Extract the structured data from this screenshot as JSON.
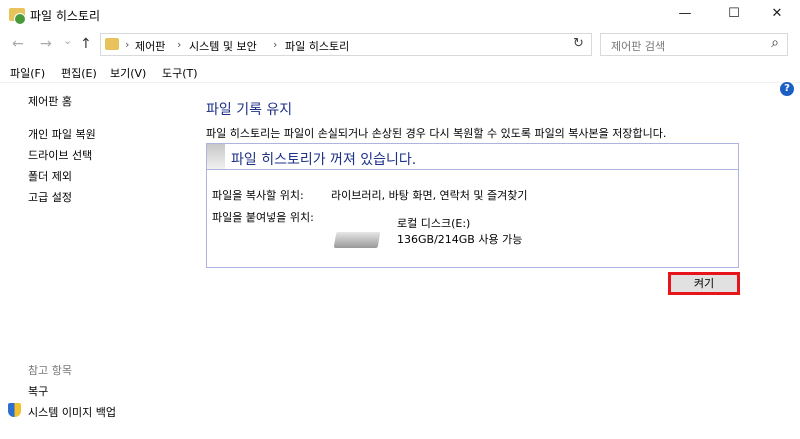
{
  "window": {
    "title": "파일 히스토리",
    "minimize": "—",
    "maximize": "☐",
    "close": "✕"
  },
  "nav": {
    "back": "←",
    "forward": "→",
    "recent": "⌄",
    "up": "↑",
    "refresh": "↻"
  },
  "breadcrumb": [
    "제어판",
    "시스템 및 보안",
    "파일 히스토리"
  ],
  "search": {
    "placeholder": "제어판 검색",
    "icon": "⌕"
  },
  "menu": [
    "파일(F)",
    "편집(E)",
    "보기(V)",
    "도구(T)"
  ],
  "sidebar": {
    "home": "제어판 홈",
    "items": [
      "개인 파일 복원",
      "드라이브 선택",
      "폴더 제외",
      "고급 설정"
    ],
    "see_also": "참고 항목",
    "links": [
      "복구",
      "시스템 이미지 백업"
    ]
  },
  "main": {
    "heading": "파일 기록 유지",
    "description": "파일 히스토리는 파일이 손실되거나 손상된 경우 다시 복원할 수 있도록 파일의 복사본을 저장합니다.",
    "status": "파일 히스토리가 꺼져 있습니다.",
    "copy_from_label": "파일을 복사할 위치:",
    "copy_from_value": "라이브러리, 바탕 화면, 연락처 및 즐겨찾기",
    "copy_to_label": "파일을 붙여넣을 위치:",
    "drive_name": "로컬 디스크(E:)",
    "drive_space": "136GB/214GB 사용 가능",
    "turn_on": "켜기",
    "help": "?"
  }
}
